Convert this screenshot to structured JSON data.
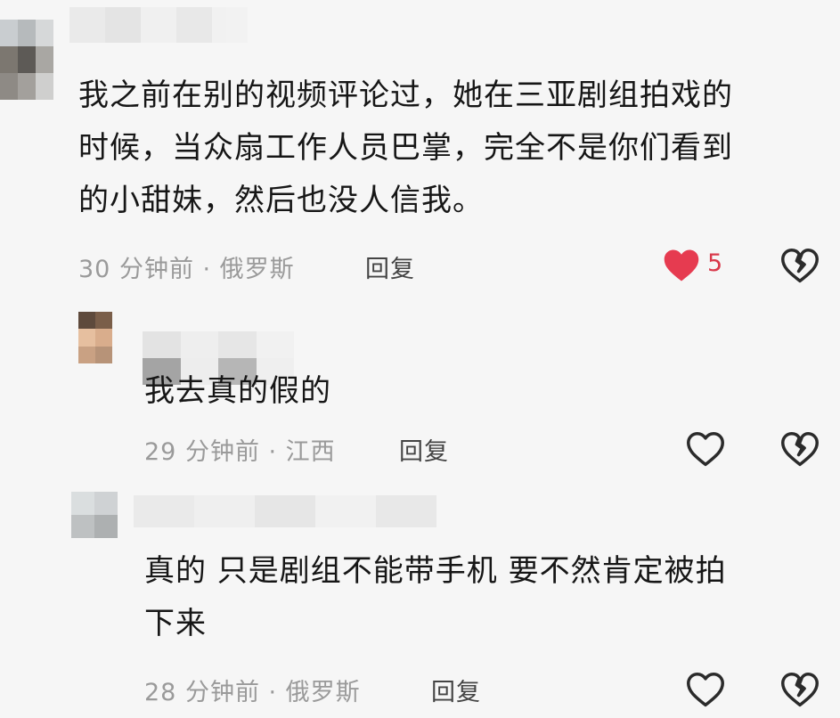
{
  "colors": {
    "accent_like": "#e63b50",
    "meta_gray": "#9a9a9a",
    "icon_gray": "#2b2b2b"
  },
  "comments": [
    {
      "text_lines": [
        "我之前在别的视频评论过，她在三亚剧组拍戏的",
        "时候，当众扇工作人员巴掌，完全不是你们看到",
        "的小甜妹，然后也没人信我。"
      ],
      "meta": "30 分钟前 · 俄罗斯",
      "reply_label": "回复",
      "like_count": "5",
      "liked": true,
      "like_icon": "heart-filled-icon",
      "dislike_icon": "broken-heart-icon"
    },
    {
      "text_lines": [
        "我去真的假的"
      ],
      "meta": "29 分钟前 · 江西",
      "reply_label": "回复",
      "liked": false,
      "like_icon": "heart-outline-icon",
      "dislike_icon": "broken-heart-icon"
    },
    {
      "text_lines": [
        "真的 只是剧组不能带手机 要不然肯定被拍",
        "下来"
      ],
      "meta": "28 分钟前 · 俄罗斯",
      "reply_label": "回复",
      "liked": false,
      "like_icon": "heart-outline-icon",
      "dislike_icon": "broken-heart-icon"
    }
  ]
}
